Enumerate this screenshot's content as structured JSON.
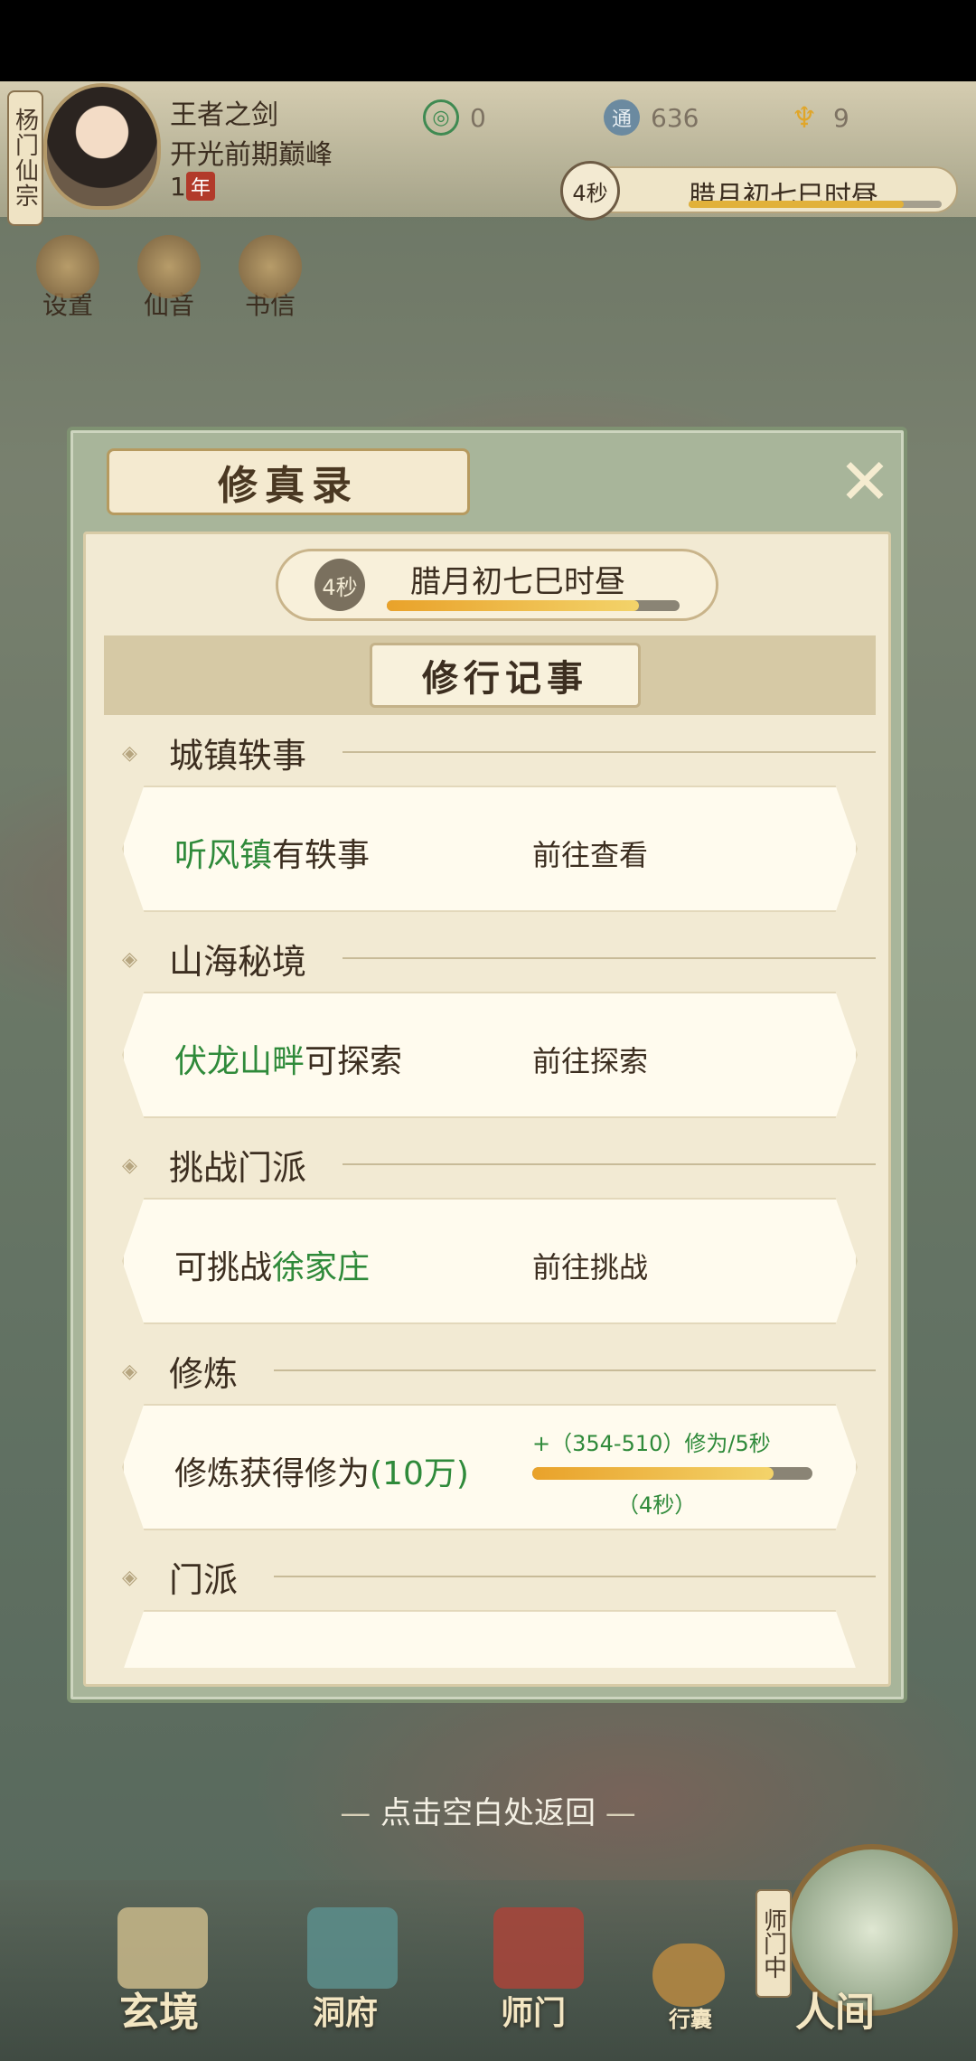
{
  "player": {
    "sect_tag": "杨门仙宗",
    "name": "王者之剑",
    "realm": "开光前期巅峰",
    "age_number": "1",
    "age_unit": "年"
  },
  "currencies": [
    {
      "icon": "jade-icon",
      "value": "0"
    },
    {
      "icon": "spirit-coin-icon",
      "value": "636"
    },
    {
      "icon": "gold-ingot-icon",
      "value": "9"
    }
  ],
  "top_time": {
    "countdown": "4秒",
    "date": "腊月初七巳时昼",
    "progress": 0.85
  },
  "shortcuts": [
    {
      "label": "设置",
      "icon": "settings-icon"
    },
    {
      "label": "仙音",
      "icon": "music-icon"
    },
    {
      "label": "书信",
      "icon": "letter-icon"
    }
  ],
  "modal": {
    "title": "修真录",
    "close_icon": "close-icon",
    "time": {
      "countdown": "4秒",
      "date": "腊月初七巳时昼",
      "progress": 0.86
    },
    "section_title": "修行记事",
    "groups": [
      {
        "title": "城镇轶事",
        "highlight": "听风镇",
        "text": "有轶事",
        "action": "前往查看"
      },
      {
        "title": "山海秘境",
        "highlight": "伏龙山畔",
        "text": "可探索",
        "action": "前往探索"
      },
      {
        "title": "挑战门派",
        "prefix": "可挑战",
        "highlight": "徐家庄",
        "action": "前往挑战"
      },
      {
        "title": "修炼",
        "text": "修炼获得修为",
        "highlight": "(10万)",
        "rate": "+（354-510）修为/5秒",
        "rate_progress": 0.86,
        "rate_time": "（4秒）"
      },
      {
        "title": "门派"
      }
    ]
  },
  "hint": "点击空白处返回",
  "bottom_nav": [
    {
      "label": "玄境",
      "icon": "scroll-icon"
    },
    {
      "label": "洞府",
      "icon": "pavilion-icon"
    },
    {
      "label": "师门",
      "icon": "banner-icon"
    },
    {
      "label": "行囊",
      "icon": "bag-icon"
    },
    {
      "label": "人间",
      "icon": "landscape-icon"
    }
  ],
  "portal_tag": "师门中",
  "colors": {
    "highlight_green": "#2f8a3a",
    "progress_gold": "#e9a22a",
    "modal_frame": "#a8b59a"
  }
}
